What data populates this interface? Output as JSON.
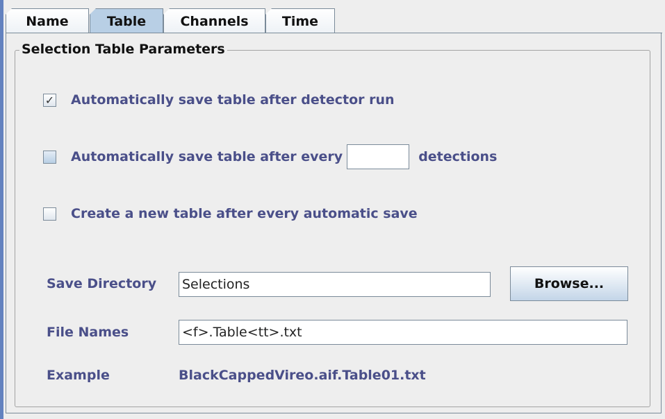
{
  "tabs": [
    {
      "label": "Name",
      "selected": false
    },
    {
      "label": "Table",
      "selected": true
    },
    {
      "label": "Channels",
      "selected": false
    },
    {
      "label": "Time",
      "selected": false
    }
  ],
  "group": {
    "title": "Selection Table Parameters"
  },
  "options": {
    "auto_save_after_run": {
      "label": "Automatically save table after detector run",
      "checked": true
    },
    "auto_save_after_every": {
      "label_before": "Automatically save table after every",
      "value": "",
      "label_after": "detections",
      "checked": false
    },
    "new_table_after_save": {
      "label": "Create a new table after every automatic save",
      "checked": false
    }
  },
  "save_directory": {
    "label": "Save Directory",
    "value": "Selections",
    "browse_label": "Browse..."
  },
  "file_names": {
    "label": "File Names",
    "value": "<f>.Table<tt>.txt"
  },
  "example": {
    "label": "Example",
    "value": "BlackCappedVireo.aif.Table01.txt"
  },
  "colors": {
    "label_text": "#4a4f89",
    "selected_tab": "#b8cfe5",
    "left_edge": "#6382bf"
  }
}
